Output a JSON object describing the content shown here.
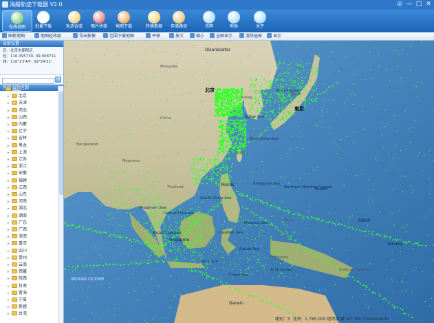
{
  "window": {
    "title": "海船轨迹下载器 V2.0",
    "controls": [
      "◎",
      "—",
      "□",
      "✕"
    ]
  },
  "ribbon": {
    "items": [
      {
        "label": "在线地图",
        "icon": "globe-icon",
        "color": "#52c04a",
        "active": true
      },
      {
        "label": "批量下载",
        "icon": "window-icon",
        "color": "#ffffff"
      },
      {
        "label": "轨迹合成",
        "icon": "merge-icon",
        "color": "#f2c24a"
      },
      {
        "label": "图片拼接",
        "icon": "puzzle-icon",
        "color": "#e44c4c"
      },
      {
        "label": "地图下载",
        "icon": "earth-icon",
        "color": "#f08a22"
      },
      {
        "label": "转换数据",
        "icon": "basket-icon",
        "color": "#f4c53a"
      },
      {
        "label": "存储路径",
        "icon": "person-icon",
        "color": "#e8b040"
      },
      {
        "label": "说明",
        "icon": "up-arrow-icon",
        "color": "#8fd0ff"
      },
      {
        "label": "帮助",
        "icon": "question-icon",
        "color": "#8fd0ff"
      },
      {
        "label": "关于",
        "icon": "info-icon",
        "color": "#8fd0ff"
      }
    ]
  },
  "toolbar2": {
    "items": [
      "图新地图",
      "地图经纬度",
      "导出影像",
      "范围下载地图",
      "平移",
      "放大",
      "缩小",
      "全图显示",
      "清除选框",
      "显示"
    ]
  },
  "left_panel": {
    "location_header": "当前位置",
    "location_lines": [
      "区：北京市朝阳区",
      "经：116.395730, 39.908711",
      "纬：116°23′44″, 39°54′31″"
    ],
    "search_placeholder": "",
    "search_button": "搜",
    "region_header": "区域·行政区划",
    "tree": [
      {
        "label": "中国",
        "level": 0,
        "expanded": true,
        "selected": true
      },
      {
        "label": "北京",
        "level": 1
      },
      {
        "label": "天津",
        "level": 1
      },
      {
        "label": "河北",
        "level": 1
      },
      {
        "label": "山西",
        "level": 1
      },
      {
        "label": "内蒙",
        "level": 1
      },
      {
        "label": "辽宁",
        "level": 1
      },
      {
        "label": "吉林",
        "level": 1
      },
      {
        "label": "黑龙",
        "level": 1
      },
      {
        "label": "上海",
        "level": 1
      },
      {
        "label": "江苏",
        "level": 1
      },
      {
        "label": "浙江",
        "level": 1
      },
      {
        "label": "安徽",
        "level": 1
      },
      {
        "label": "福建",
        "level": 1
      },
      {
        "label": "江西",
        "level": 1
      },
      {
        "label": "山东",
        "level": 1
      },
      {
        "label": "河南",
        "level": 1
      },
      {
        "label": "湖北",
        "level": 1
      },
      {
        "label": "湖南",
        "level": 1
      },
      {
        "label": "广东",
        "level": 1
      },
      {
        "label": "广西",
        "level": 1
      },
      {
        "label": "海南",
        "level": 1
      },
      {
        "label": "重庆",
        "level": 1
      },
      {
        "label": "四川",
        "level": 1
      },
      {
        "label": "贵州",
        "level": 1
      },
      {
        "label": "云南",
        "level": 1
      },
      {
        "label": "西藏",
        "level": 1
      },
      {
        "label": "陕西",
        "level": 1
      },
      {
        "label": "甘肃",
        "level": 1
      },
      {
        "label": "青海",
        "level": 1
      },
      {
        "label": "宁夏",
        "level": 1
      },
      {
        "label": "新疆",
        "level": 1
      },
      {
        "label": "台湾",
        "level": 1
      }
    ]
  },
  "map": {
    "track_color": "#39ff2e",
    "labels": [
      {
        "text": "Ulaanbaatar",
        "cls": "city"
      },
      {
        "text": "Mongolia",
        "cls": "country"
      },
      {
        "text": "北京",
        "cls": "cap"
      },
      {
        "text": "Korea",
        "cls": "country"
      },
      {
        "text": "Sea of Japan",
        "cls": "sea"
      },
      {
        "text": "Japan",
        "cls": "country"
      },
      {
        "text": "東京",
        "cls": "cap"
      },
      {
        "text": "China",
        "cls": "country"
      },
      {
        "text": "Yellow Sea",
        "cls": "sea"
      },
      {
        "text": "East China Sea",
        "cls": "sea"
      },
      {
        "text": "Taiwan",
        "cls": "country"
      },
      {
        "text": "Bangladesh",
        "cls": "country"
      },
      {
        "text": "Myanmar",
        "cls": "country"
      },
      {
        "text": "Thailand",
        "cls": "country"
      },
      {
        "text": "Manila",
        "cls": "city"
      },
      {
        "text": "Philippine Sea",
        "cls": "sea"
      },
      {
        "text": "Northern Mariana Islands",
        "cls": "sea"
      },
      {
        "text": "Guam",
        "cls": "city"
      },
      {
        "text": "South China Sea",
        "cls": "sea"
      },
      {
        "text": "Andaman Sea",
        "cls": "sea"
      },
      {
        "text": "Gulf of Thailand",
        "cls": "sea"
      },
      {
        "text": "Kuala Lumpur",
        "cls": "city"
      },
      {
        "text": "Singapore",
        "cls": "city"
      },
      {
        "text": "Celebes Sea",
        "cls": "sea"
      },
      {
        "text": "Molucca Sea",
        "cls": "sea"
      },
      {
        "text": "Palau",
        "cls": "country"
      },
      {
        "text": "Palikir",
        "cls": "city"
      },
      {
        "text": "Tarawa",
        "cls": "city"
      },
      {
        "text": "Banda Sea",
        "cls": "sea"
      },
      {
        "text": "Indonesia",
        "cls": "country"
      },
      {
        "text": "Java Sea",
        "cls": "sea"
      },
      {
        "text": "Arafura Sea",
        "cls": "sea"
      },
      {
        "text": "Timor Sea",
        "cls": "sea"
      },
      {
        "text": "Solomon Islands",
        "cls": "country"
      },
      {
        "text": "INDIAN OCEAN",
        "cls": "ocean"
      },
      {
        "text": "Darwin",
        "cls": "city"
      }
    ]
  },
  "status": {
    "level": "级别：5",
    "scale": "比例",
    "coords": "1,785,000   经纬度/度   Arc GIS Components"
  }
}
